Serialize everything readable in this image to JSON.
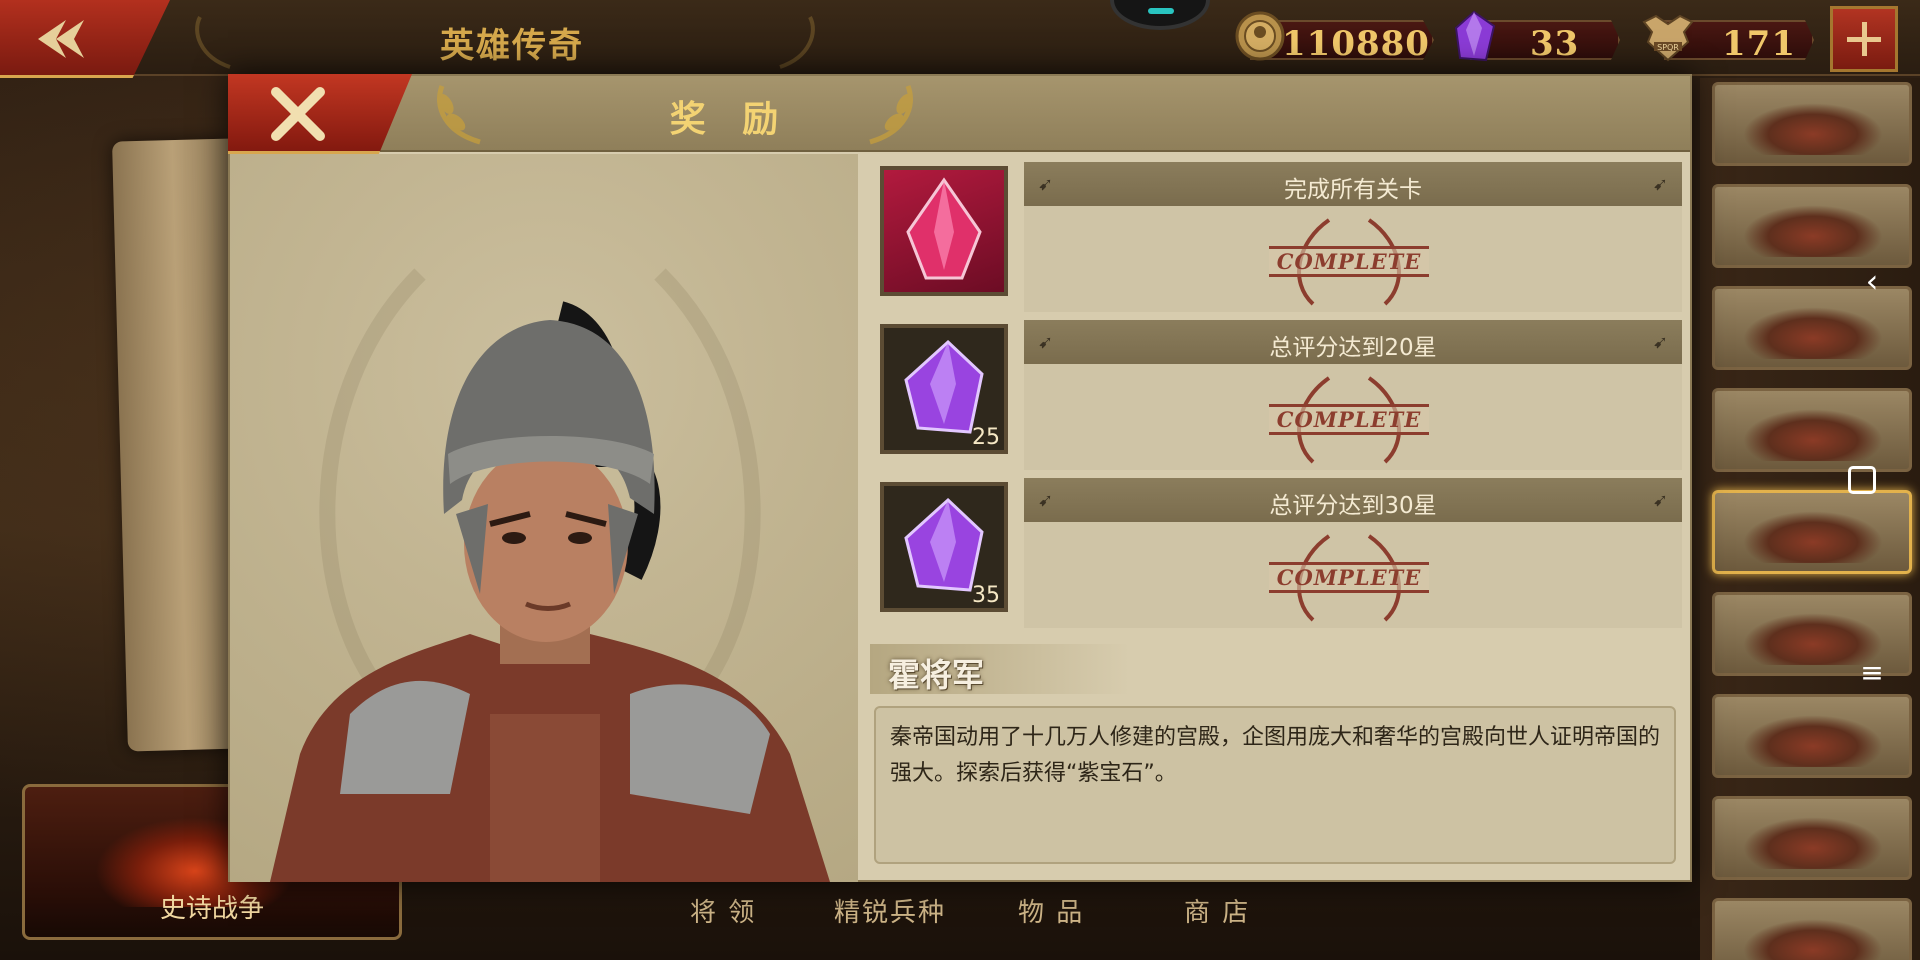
{
  "topbar": {
    "title": "英雄传奇",
    "coins": "110880",
    "gems": "33",
    "tokens": "171",
    "token_emblem_text": "SPQR"
  },
  "modal": {
    "title": "奖 励",
    "rewards": [
      {
        "label": "完成所有关卡",
        "status": "COMPLETE",
        "icon": "ruby-gem-icon",
        "count": ""
      },
      {
        "label": "总评分达到20星",
        "status": "COMPLETE",
        "icon": "purple-gem-icon",
        "count": "25"
      },
      {
        "label": "总评分达到30星",
        "status": "COMPLETE",
        "icon": "purple-gem-icon",
        "count": "35"
      }
    ],
    "hero_name": "霍将军",
    "description": "秦帝国动用了十几万人修建的宫殿，企图用庞大和奢华的宫殿向世人证明帝国的强大。探索后获得“紫宝石”。"
  },
  "bottom_nav": {
    "epic_war": "史诗战争",
    "items": [
      "将 领",
      "精锐兵种",
      "物 品",
      "商 店"
    ]
  },
  "colors": {
    "accent_red": "#b3301e",
    "gold": "#e9c77a",
    "stamp_red": "#8c3d2e",
    "parchment": "#d7ccae"
  }
}
